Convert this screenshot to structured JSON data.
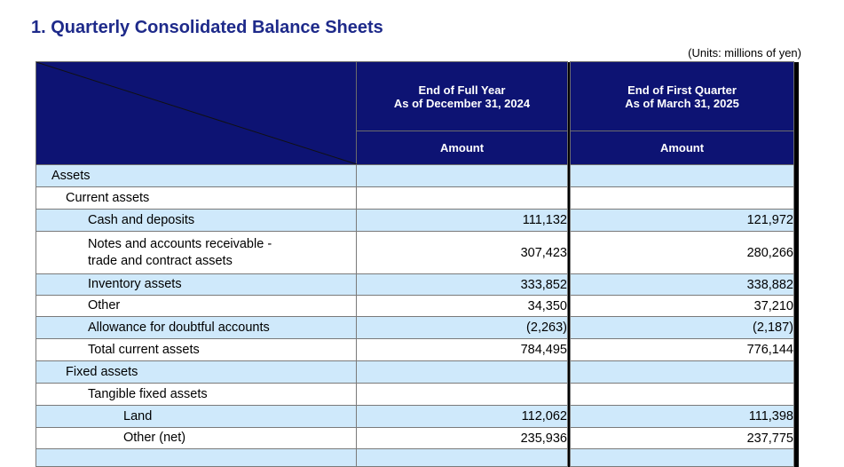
{
  "document": {
    "section_title": "1. Quarterly Consolidated Balance Sheets",
    "units_note": "(Units: millions of yen)"
  },
  "table": {
    "columns": [
      {
        "period": "End of Full Year",
        "date": "As of December 31, 2024",
        "subheader": "Amount"
      },
      {
        "period": "End of First Quarter",
        "date": "As of March 31, 2025",
        "subheader": "Amount"
      }
    ],
    "rows": [
      {
        "label": "Assets",
        "level": 0,
        "prev": "",
        "curr": ""
      },
      {
        "label": "Current assets",
        "level": 1,
        "prev": "",
        "curr": ""
      },
      {
        "label": "Cash and deposits",
        "level": 2,
        "prev": "111,132",
        "curr": "121,972"
      },
      {
        "label": "Notes and accounts receivable - trade and contract assets",
        "level": 2,
        "prev": "307,423",
        "curr": "280,266"
      },
      {
        "label": "Inventory assets",
        "level": 2,
        "prev": "333,852",
        "curr": "338,882"
      },
      {
        "label": "Other",
        "level": 2,
        "prev": "34,350",
        "curr": "37,210"
      },
      {
        "label": "Allowance for doubtful accounts",
        "level": 2,
        "prev": "(2,263)",
        "curr": "(2,187)"
      },
      {
        "label": "Total current assets",
        "level": 2,
        "prev": "784,495",
        "curr": "776,144"
      },
      {
        "label": "Fixed assets",
        "level": 1,
        "prev": "",
        "curr": ""
      },
      {
        "label": "Tangible fixed assets",
        "level": 2,
        "prev": "",
        "curr": ""
      },
      {
        "label": "Land",
        "level": 3,
        "prev": "112,062",
        "curr": "111,398"
      },
      {
        "label": "Other (net)",
        "level": 3,
        "prev": "235,936",
        "curr": "237,775"
      },
      {
        "label": "",
        "level": 3,
        "prev": "",
        "curr": ""
      }
    ]
  },
  "colors": {
    "header_bg": "#0d1373",
    "title_color": "#1e2a8a",
    "row_alt_bg": "#cfe9fb"
  }
}
